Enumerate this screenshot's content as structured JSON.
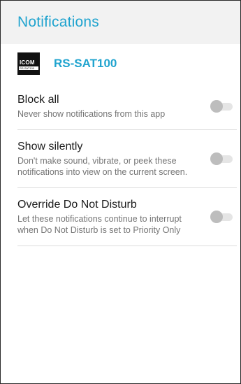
{
  "header": {
    "title": "Notifications"
  },
  "app": {
    "icon": "icom-rs-sat100-app-icon",
    "logo_text": "ICOM",
    "logo_subtext": "RS-SAT100",
    "name": "RS-SAT100"
  },
  "settings": [
    {
      "title": "Block all",
      "description": "Never show notifications from this app",
      "enabled": false
    },
    {
      "title": "Show silently",
      "description": "Don't make sound, vibrate, or peek these notifications into view on the current screen.",
      "enabled": false
    },
    {
      "title": "Override Do Not Disturb",
      "description": "Let these notifications continue to interrupt when Do Not Disturb is set to Priority Only",
      "enabled": false
    }
  ],
  "colors": {
    "accent": "#21a4cf",
    "header_bg": "#f2f2f2",
    "toggle_thumb_off": "#bdbdbd",
    "toggle_track_off": "#e5e5e5"
  }
}
